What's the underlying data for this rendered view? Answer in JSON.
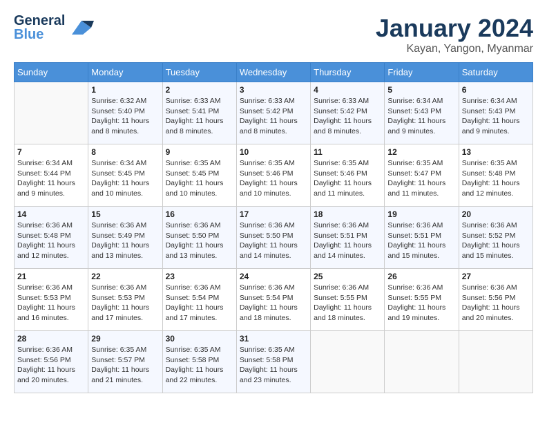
{
  "header": {
    "logo_line1": "General",
    "logo_line2": "Blue",
    "month": "January 2024",
    "location": "Kayan, Yangon, Myanmar"
  },
  "weekdays": [
    "Sunday",
    "Monday",
    "Tuesday",
    "Wednesday",
    "Thursday",
    "Friday",
    "Saturday"
  ],
  "weeks": [
    [
      {
        "day": "",
        "sunrise": "",
        "sunset": "",
        "daylight": ""
      },
      {
        "day": "1",
        "sunrise": "Sunrise: 6:32 AM",
        "sunset": "Sunset: 5:40 PM",
        "daylight": "Daylight: 11 hours and 8 minutes."
      },
      {
        "day": "2",
        "sunrise": "Sunrise: 6:33 AM",
        "sunset": "Sunset: 5:41 PM",
        "daylight": "Daylight: 11 hours and 8 minutes."
      },
      {
        "day": "3",
        "sunrise": "Sunrise: 6:33 AM",
        "sunset": "Sunset: 5:42 PM",
        "daylight": "Daylight: 11 hours and 8 minutes."
      },
      {
        "day": "4",
        "sunrise": "Sunrise: 6:33 AM",
        "sunset": "Sunset: 5:42 PM",
        "daylight": "Daylight: 11 hours and 8 minutes."
      },
      {
        "day": "5",
        "sunrise": "Sunrise: 6:34 AM",
        "sunset": "Sunset: 5:43 PM",
        "daylight": "Daylight: 11 hours and 9 minutes."
      },
      {
        "day": "6",
        "sunrise": "Sunrise: 6:34 AM",
        "sunset": "Sunset: 5:43 PM",
        "daylight": "Daylight: 11 hours and 9 minutes."
      }
    ],
    [
      {
        "day": "7",
        "sunrise": "Sunrise: 6:34 AM",
        "sunset": "Sunset: 5:44 PM",
        "daylight": "Daylight: 11 hours and 9 minutes."
      },
      {
        "day": "8",
        "sunrise": "Sunrise: 6:34 AM",
        "sunset": "Sunset: 5:45 PM",
        "daylight": "Daylight: 11 hours and 10 minutes."
      },
      {
        "day": "9",
        "sunrise": "Sunrise: 6:35 AM",
        "sunset": "Sunset: 5:45 PM",
        "daylight": "Daylight: 11 hours and 10 minutes."
      },
      {
        "day": "10",
        "sunrise": "Sunrise: 6:35 AM",
        "sunset": "Sunset: 5:46 PM",
        "daylight": "Daylight: 11 hours and 10 minutes."
      },
      {
        "day": "11",
        "sunrise": "Sunrise: 6:35 AM",
        "sunset": "Sunset: 5:46 PM",
        "daylight": "Daylight: 11 hours and 11 minutes."
      },
      {
        "day": "12",
        "sunrise": "Sunrise: 6:35 AM",
        "sunset": "Sunset: 5:47 PM",
        "daylight": "Daylight: 11 hours and 11 minutes."
      },
      {
        "day": "13",
        "sunrise": "Sunrise: 6:35 AM",
        "sunset": "Sunset: 5:48 PM",
        "daylight": "Daylight: 11 hours and 12 minutes."
      }
    ],
    [
      {
        "day": "14",
        "sunrise": "Sunrise: 6:36 AM",
        "sunset": "Sunset: 5:48 PM",
        "daylight": "Daylight: 11 hours and 12 minutes."
      },
      {
        "day": "15",
        "sunrise": "Sunrise: 6:36 AM",
        "sunset": "Sunset: 5:49 PM",
        "daylight": "Daylight: 11 hours and 13 minutes."
      },
      {
        "day": "16",
        "sunrise": "Sunrise: 6:36 AM",
        "sunset": "Sunset: 5:50 PM",
        "daylight": "Daylight: 11 hours and 13 minutes."
      },
      {
        "day": "17",
        "sunrise": "Sunrise: 6:36 AM",
        "sunset": "Sunset: 5:50 PM",
        "daylight": "Daylight: 11 hours and 14 minutes."
      },
      {
        "day": "18",
        "sunrise": "Sunrise: 6:36 AM",
        "sunset": "Sunset: 5:51 PM",
        "daylight": "Daylight: 11 hours and 14 minutes."
      },
      {
        "day": "19",
        "sunrise": "Sunrise: 6:36 AM",
        "sunset": "Sunset: 5:51 PM",
        "daylight": "Daylight: 11 hours and 15 minutes."
      },
      {
        "day": "20",
        "sunrise": "Sunrise: 6:36 AM",
        "sunset": "Sunset: 5:52 PM",
        "daylight": "Daylight: 11 hours and 15 minutes."
      }
    ],
    [
      {
        "day": "21",
        "sunrise": "Sunrise: 6:36 AM",
        "sunset": "Sunset: 5:53 PM",
        "daylight": "Daylight: 11 hours and 16 minutes."
      },
      {
        "day": "22",
        "sunrise": "Sunrise: 6:36 AM",
        "sunset": "Sunset: 5:53 PM",
        "daylight": "Daylight: 11 hours and 17 minutes."
      },
      {
        "day": "23",
        "sunrise": "Sunrise: 6:36 AM",
        "sunset": "Sunset: 5:54 PM",
        "daylight": "Daylight: 11 hours and 17 minutes."
      },
      {
        "day": "24",
        "sunrise": "Sunrise: 6:36 AM",
        "sunset": "Sunset: 5:54 PM",
        "daylight": "Daylight: 11 hours and 18 minutes."
      },
      {
        "day": "25",
        "sunrise": "Sunrise: 6:36 AM",
        "sunset": "Sunset: 5:55 PM",
        "daylight": "Daylight: 11 hours and 18 minutes."
      },
      {
        "day": "26",
        "sunrise": "Sunrise: 6:36 AM",
        "sunset": "Sunset: 5:55 PM",
        "daylight": "Daylight: 11 hours and 19 minutes."
      },
      {
        "day": "27",
        "sunrise": "Sunrise: 6:36 AM",
        "sunset": "Sunset: 5:56 PM",
        "daylight": "Daylight: 11 hours and 20 minutes."
      }
    ],
    [
      {
        "day": "28",
        "sunrise": "Sunrise: 6:36 AM",
        "sunset": "Sunset: 5:56 PM",
        "daylight": "Daylight: 11 hours and 20 minutes."
      },
      {
        "day": "29",
        "sunrise": "Sunrise: 6:35 AM",
        "sunset": "Sunset: 5:57 PM",
        "daylight": "Daylight: 11 hours and 21 minutes."
      },
      {
        "day": "30",
        "sunrise": "Sunrise: 6:35 AM",
        "sunset": "Sunset: 5:58 PM",
        "daylight": "Daylight: 11 hours and 22 minutes."
      },
      {
        "day": "31",
        "sunrise": "Sunrise: 6:35 AM",
        "sunset": "Sunset: 5:58 PM",
        "daylight": "Daylight: 11 hours and 23 minutes."
      },
      {
        "day": "",
        "sunrise": "",
        "sunset": "",
        "daylight": ""
      },
      {
        "day": "",
        "sunrise": "",
        "sunset": "",
        "daylight": ""
      },
      {
        "day": "",
        "sunrise": "",
        "sunset": "",
        "daylight": ""
      }
    ]
  ]
}
